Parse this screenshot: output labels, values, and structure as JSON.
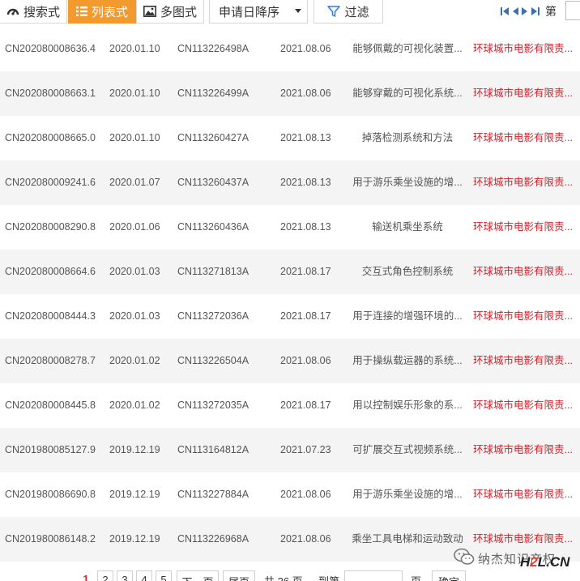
{
  "toolbar": {
    "search_mode": "搜索式",
    "list_mode": "列表式",
    "multi_mode": "多图式",
    "sort_label": "申请日降序",
    "filter_label": "过滤",
    "page_prefix": "第"
  },
  "rows": [
    {
      "app_no": "CN202080008636.4",
      "app_date": "2020.01.10",
      "pub_no": "CN113226498A",
      "pub_date": "2021.08.06",
      "title": "能够佩戴的可视化装置...",
      "owner": "环球城市电影有限责..."
    },
    {
      "app_no": "CN202080008663.1",
      "app_date": "2020.01.10",
      "pub_no": "CN113226499A",
      "pub_date": "2021.08.06",
      "title": "能够穿戴的可视化系统...",
      "owner": "环球城市电影有限责..."
    },
    {
      "app_no": "CN202080008665.0",
      "app_date": "2020.01.10",
      "pub_no": "CN113260427A",
      "pub_date": "2021.08.13",
      "title": "掉落检测系统和方法",
      "owner": "环球城市电影有限责..."
    },
    {
      "app_no": "CN202080009241.6",
      "app_date": "2020.01.07",
      "pub_no": "CN113260437A",
      "pub_date": "2021.08.13",
      "title": "用于游乐乘坐设施的增...",
      "owner": "环球城市电影有限责..."
    },
    {
      "app_no": "CN202080008290.8",
      "app_date": "2020.01.06",
      "pub_no": "CN113260436A",
      "pub_date": "2021.08.13",
      "title": "输送机乘坐系统",
      "owner": "环球城市电影有限责..."
    },
    {
      "app_no": "CN202080008664.6",
      "app_date": "2020.01.03",
      "pub_no": "CN113271813A",
      "pub_date": "2021.08.17",
      "title": "交互式角色控制系统",
      "owner": "环球城市电影有限责..."
    },
    {
      "app_no": "CN202080008444.3",
      "app_date": "2020.01.03",
      "pub_no": "CN113272036A",
      "pub_date": "2021.08.17",
      "title": "用于连接的增强环境的...",
      "owner": "环球城市电影有限责..."
    },
    {
      "app_no": "CN202080008278.7",
      "app_date": "2020.01.02",
      "pub_no": "CN113226504A",
      "pub_date": "2021.08.06",
      "title": "用于操纵载运器的系统...",
      "owner": "环球城市电影有限责..."
    },
    {
      "app_no": "CN202080008445.8",
      "app_date": "2020.01.02",
      "pub_no": "CN113272035A",
      "pub_date": "2021.08.17",
      "title": "用以控制娱乐形象的系...",
      "owner": "环球城市电影有限责..."
    },
    {
      "app_no": "CN201980085127.9",
      "app_date": "2019.12.19",
      "pub_no": "CN113164812A",
      "pub_date": "2021.07.23",
      "title": "可扩展交互式视频系统...",
      "owner": "环球城市电影有限责..."
    },
    {
      "app_no": "CN201980086690.8",
      "app_date": "2019.12.19",
      "pub_no": "CN113227884A",
      "pub_date": "2021.08.06",
      "title": "用于游乐乘坐设施的增...",
      "owner": "环球城市电影有限责..."
    },
    {
      "app_no": "CN201980086148.2",
      "app_date": "2019.12.19",
      "pub_no": "CN113226968A",
      "pub_date": "2021.08.06",
      "title": "乘坐工具电梯和运动致动",
      "owner": "环球城市电影有限责..."
    }
  ],
  "pager": {
    "current": "1",
    "pages": [
      "2",
      "3",
      "4",
      "5"
    ],
    "next_label": "下一页",
    "last_label": "尾页",
    "total_text": "共 26 页",
    "goto_label": "到第",
    "page_unit": "页",
    "confirm_label": "确定"
  },
  "watermark": {
    "text": "纳杰知识产权",
    "brand_a": "H",
    "brand_b": "2",
    "brand_c": "L.CN"
  }
}
